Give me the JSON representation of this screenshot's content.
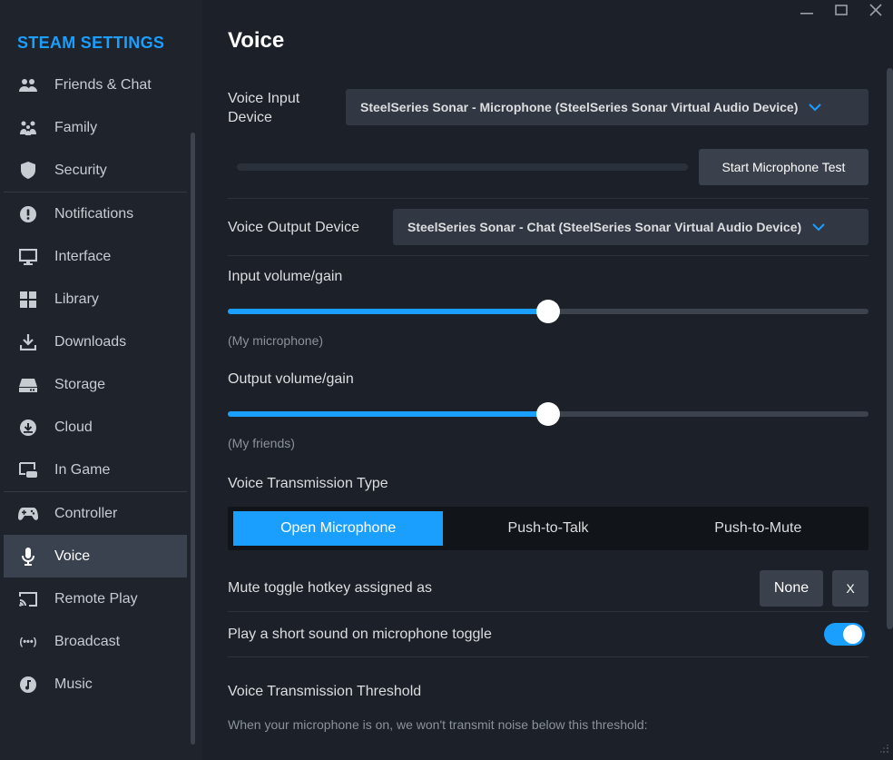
{
  "sidebar": {
    "title": "STEAM SETTINGS",
    "items": [
      {
        "label": "Friends & Chat",
        "icon": "friends-icon"
      },
      {
        "label": "Family",
        "icon": "family-icon"
      },
      {
        "label": "Security",
        "icon": "shield-icon"
      },
      {
        "label": "Notifications",
        "icon": "alert-icon"
      },
      {
        "label": "Interface",
        "icon": "monitor-icon"
      },
      {
        "label": "Library",
        "icon": "grid-icon"
      },
      {
        "label": "Downloads",
        "icon": "download-icon"
      },
      {
        "label": "Storage",
        "icon": "drive-icon"
      },
      {
        "label": "Cloud",
        "icon": "cloud-icon"
      },
      {
        "label": "In Game",
        "icon": "ingame-icon"
      },
      {
        "label": "Controller",
        "icon": "gamepad-icon"
      },
      {
        "label": "Voice",
        "icon": "microphone-icon"
      },
      {
        "label": "Remote Play",
        "icon": "cast-icon"
      },
      {
        "label": "Broadcast",
        "icon": "broadcast-icon"
      },
      {
        "label": "Music",
        "icon": "music-icon"
      }
    ],
    "active": "Voice",
    "broadcast_glyph": "(•••)"
  },
  "main": {
    "title": "Voice",
    "input_device": {
      "label": "Voice Input Device",
      "value": "SteelSeries Sonar - Microphone (SteelSeries Sonar Virtual Audio Device)"
    },
    "mic_test_button": "Start Microphone Test",
    "output_device": {
      "label": "Voice Output Device",
      "value": "SteelSeries Sonar - Chat (SteelSeries Sonar Virtual Audio Device)"
    },
    "input_volume": {
      "label": "Input volume/gain",
      "sub": "(My microphone)",
      "level": 0.5
    },
    "output_volume": {
      "label": "Output volume/gain",
      "sub": "(My friends)",
      "level": 0.5
    },
    "transmission": {
      "label": "Voice Transmission Type",
      "options": [
        "Open Microphone",
        "Push-to-Talk",
        "Push-to-Mute"
      ],
      "selected": "Open Microphone"
    },
    "mute_hotkey": {
      "label": "Mute toggle hotkey assigned as",
      "value": "None",
      "clear": "X"
    },
    "toggle_sound": {
      "label": "Play a short sound on microphone toggle",
      "enabled": true
    },
    "threshold": {
      "label": "Voice Transmission Threshold",
      "desc": "When your microphone is on, we won't transmit noise below this threshold:"
    }
  },
  "colors": {
    "accent": "#1a9fff",
    "sidebar_title": "#1a9fff"
  }
}
